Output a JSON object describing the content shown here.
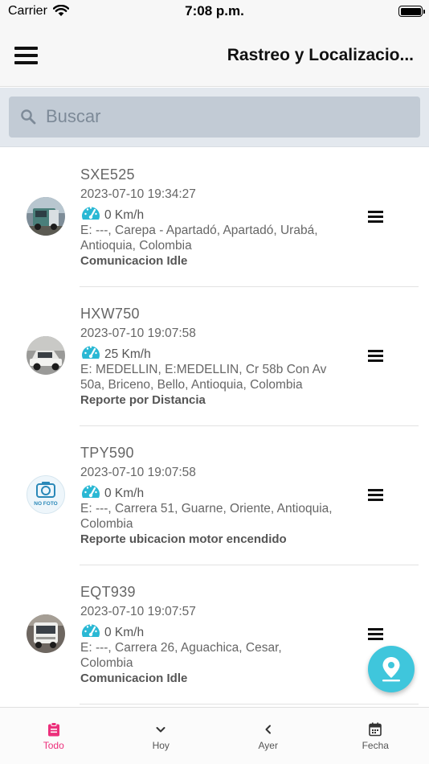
{
  "status_bar": {
    "carrier": "Carrier",
    "time": "7:08 p.m."
  },
  "header": {
    "title": "Rastreo y Localizacio..."
  },
  "search": {
    "placeholder": "Buscar",
    "value": ""
  },
  "vehicles": [
    {
      "plate": "SXE525",
      "datetime": "2023-07-10 19:34:27",
      "speed": "0 Km/h",
      "address_line1": "E: ---, Carepa - Apartadó, Apartadó, Urabá,",
      "address_line2": "Antioquia, Colombia",
      "status": "Comunicacion Idle",
      "avatar": "truck-photo"
    },
    {
      "plate": "HXW750",
      "datetime": "2023-07-10 19:07:58",
      "speed": "25 Km/h",
      "address_line1": "E: MEDELLIN, E:MEDELLIN, Cr 58b Con Av",
      "address_line2": "50a, Briceno, Bello, Antioquia, Colombia",
      "status": "Reporte por Distancia",
      "avatar": "car-photo"
    },
    {
      "plate": "TPY590",
      "datetime": "2023-07-10 19:07:58",
      "speed": "0 Km/h",
      "address_line1": "E: ---, Carrera 51, Guarne, Oriente, Antioquia,",
      "address_line2": "Colombia",
      "status": "Reporte ubicacion motor encendido",
      "avatar": "no-photo",
      "avatar_label": "NO FOTO"
    },
    {
      "plate": "EQT939",
      "datetime": "2023-07-10 19:07:57",
      "speed": "0 Km/h",
      "address_line1": "E: ---, Carrera 26, Aguachica, Cesar,",
      "address_line2": "Colombia",
      "status": "Comunicacion Idle",
      "avatar": "truck-photo"
    }
  ],
  "tabs": [
    {
      "label": "Todo",
      "icon": "clipboard-icon",
      "active": true
    },
    {
      "label": "Hoy",
      "icon": "chevron-down-icon",
      "active": false
    },
    {
      "label": "Ayer",
      "icon": "chevron-left-icon",
      "active": false
    },
    {
      "label": "Fecha",
      "icon": "calendar-icon",
      "active": false
    }
  ],
  "colors": {
    "accent_teal": "#3fc6dc",
    "active_tab": "#ec2f7b",
    "search_bg": "#c2cbd5"
  }
}
